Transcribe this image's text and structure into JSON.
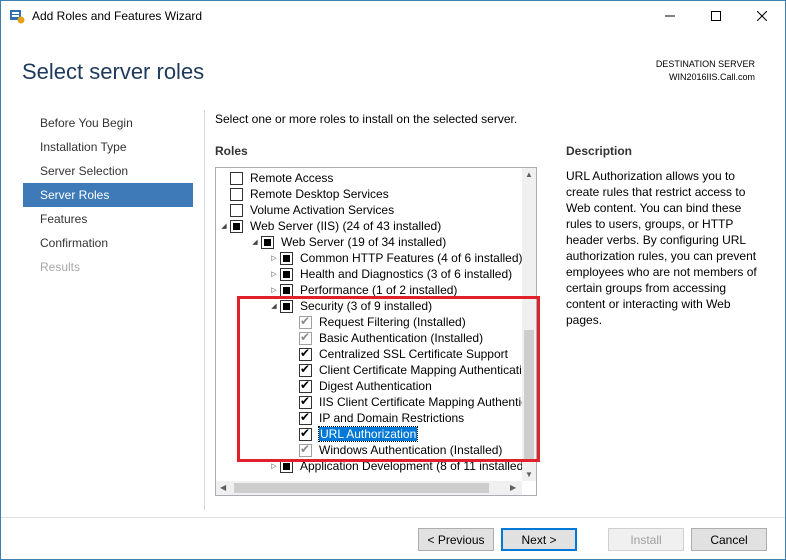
{
  "window": {
    "title": "Add Roles and Features Wizard"
  },
  "header": {
    "page_title": "Select server roles",
    "destination_label": "DESTINATION SERVER",
    "destination_server": "WIN2016IIS.Call.com"
  },
  "nav": {
    "items": [
      {
        "label": "Before You Begin",
        "state": "normal"
      },
      {
        "label": "Installation Type",
        "state": "normal"
      },
      {
        "label": "Server Selection",
        "state": "normal"
      },
      {
        "label": "Server Roles",
        "state": "active"
      },
      {
        "label": "Features",
        "state": "normal"
      },
      {
        "label": "Confirmation",
        "state": "normal"
      },
      {
        "label": "Results",
        "state": "disabled"
      }
    ]
  },
  "main": {
    "instruction": "Select one or more roles to install on the selected server.",
    "roles_label": "Roles",
    "description_label": "Description",
    "description_text": "URL Authorization allows you to create rules that restrict access to Web content. You can bind these rules to users, groups, or HTTP header verbs. By configuring URL authorization rules, you can prevent employees who are not members of certain groups from accessing content or interacting with Web pages."
  },
  "roles_tree": [
    {
      "label": "Remote Access",
      "check": "none",
      "expander": "",
      "indent": 0
    },
    {
      "label": "Remote Desktop Services",
      "check": "none",
      "expander": "",
      "indent": 0
    },
    {
      "label": "Volume Activation Services",
      "check": "none",
      "expander": "",
      "indent": 0
    },
    {
      "label": "Web Server (IIS) (24 of 43 installed)",
      "check": "partial",
      "expander": "expanded",
      "indent": 0
    },
    {
      "label": "Web Server (19 of 34 installed)",
      "check": "partial",
      "expander": "expanded",
      "indent": 1
    },
    {
      "label": "Common HTTP Features (4 of 6 installed)",
      "check": "partial",
      "expander": "collapsed",
      "indent": 2
    },
    {
      "label": "Health and Diagnostics (3 of 6 installed)",
      "check": "partial",
      "expander": "collapsed",
      "indent": 2
    },
    {
      "label": "Performance (1 of 2 installed)",
      "check": "partial",
      "expander": "collapsed",
      "indent": 2
    },
    {
      "label": "Security (3 of 9 installed)",
      "check": "partial",
      "expander": "expanded",
      "indent": 2
    },
    {
      "label": "Request Filtering (Installed)",
      "check": "checked-grey",
      "expander": "",
      "indent": 3
    },
    {
      "label": "Basic Authentication (Installed)",
      "check": "checked-grey",
      "expander": "",
      "indent": 3
    },
    {
      "label": "Centralized SSL Certificate Support",
      "check": "checked",
      "expander": "",
      "indent": 3
    },
    {
      "label": "Client Certificate Mapping Authentication",
      "check": "checked",
      "expander": "",
      "indent": 3
    },
    {
      "label": "Digest Authentication",
      "check": "checked",
      "expander": "",
      "indent": 3
    },
    {
      "label": "IIS Client Certificate Mapping Authentication",
      "check": "checked",
      "expander": "",
      "indent": 3
    },
    {
      "label": "IP and Domain Restrictions",
      "check": "checked",
      "expander": "",
      "indent": 3
    },
    {
      "label": "URL Authorization",
      "check": "checked",
      "expander": "",
      "indent": 3,
      "selected": true
    },
    {
      "label": "Windows Authentication (Installed)",
      "check": "checked-grey",
      "expander": "",
      "indent": 3
    },
    {
      "label": "Application Development (8 of 11 installed)",
      "check": "partial",
      "expander": "collapsed",
      "indent": 2
    }
  ],
  "buttons": {
    "previous": "< Previous",
    "next": "Next >",
    "install": "Install",
    "cancel": "Cancel"
  },
  "colors": {
    "accent": "#3d7ab7",
    "title": "#1e395b",
    "highlight_box": "#e0202a",
    "selection": "#0078d7"
  }
}
